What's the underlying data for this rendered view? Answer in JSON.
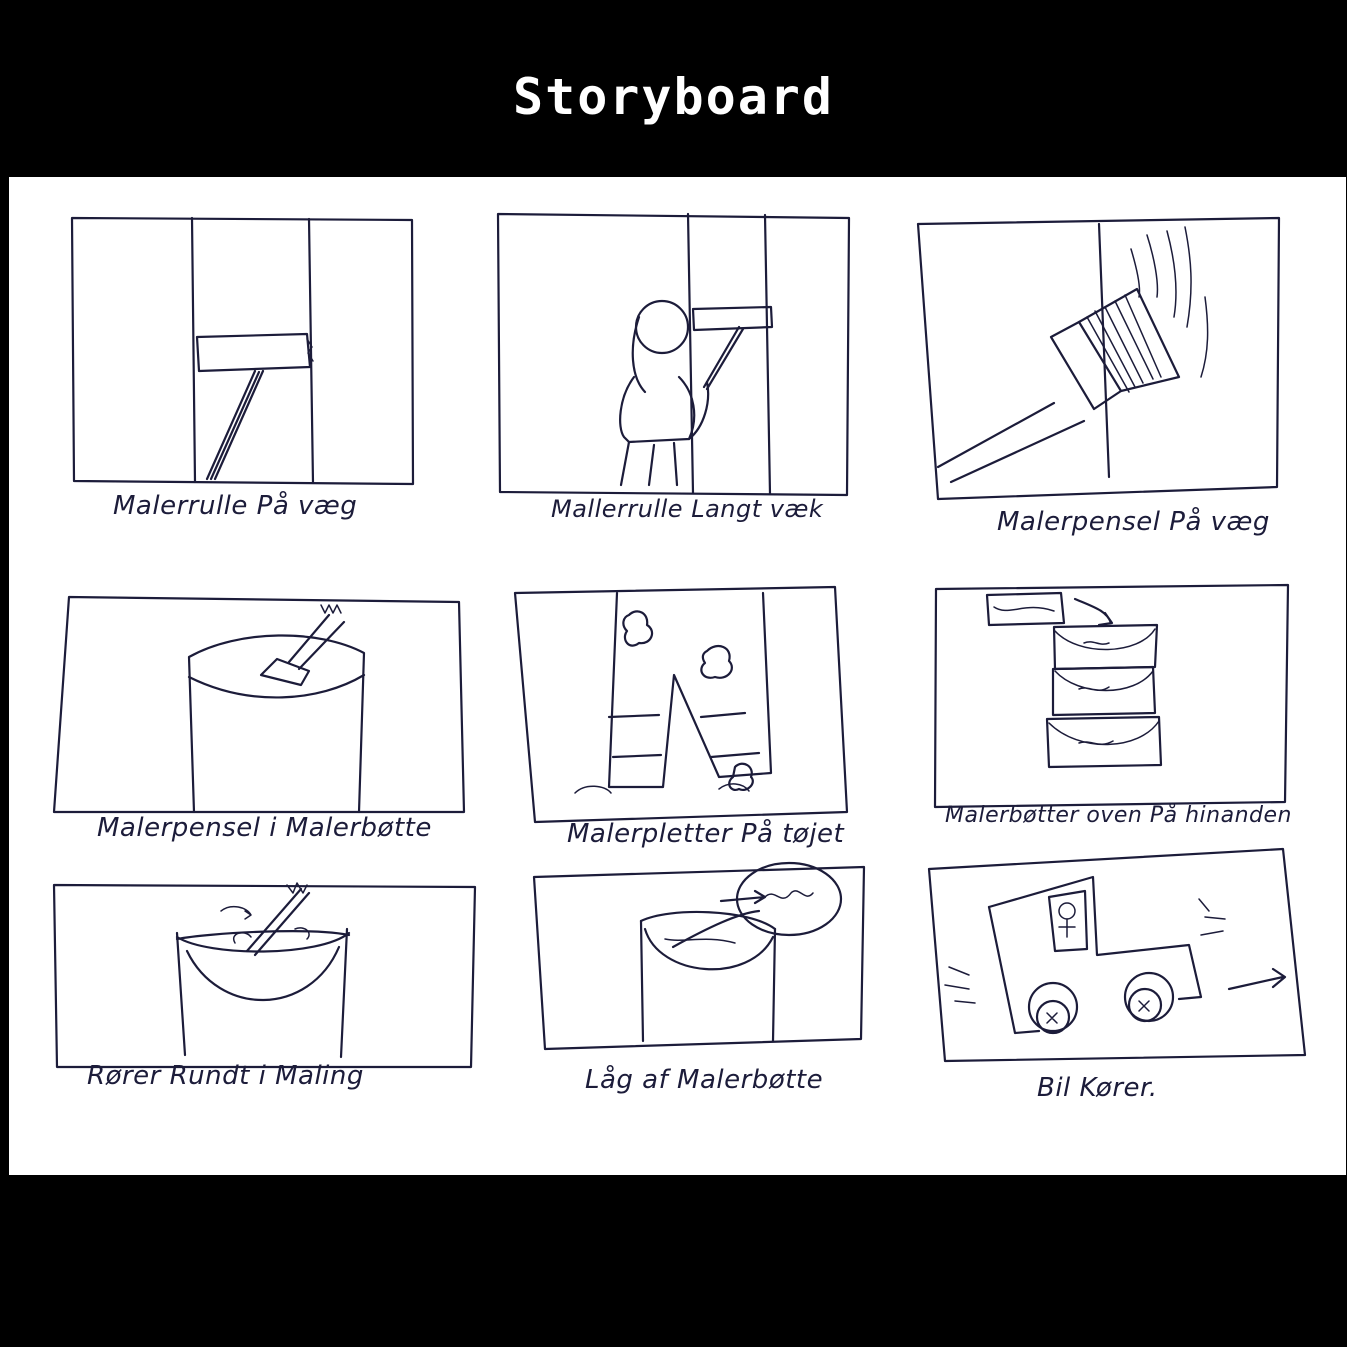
{
  "title": "Storyboard",
  "panels": [
    {
      "caption": "Malerrulle På væg"
    },
    {
      "caption": "Mallerrulle Langt væk"
    },
    {
      "caption": "Malerpensel På væg"
    },
    {
      "caption": "Malerpensel i Malerbøtte"
    },
    {
      "caption": "Malerpletter På tøjet"
    },
    {
      "caption": "Malerbøtter oven På hinanden"
    },
    {
      "caption": "Rører Rundt i Maling"
    },
    {
      "caption": "Låg af Malerbøtte"
    },
    {
      "caption": "Bil Kører."
    }
  ],
  "colors": {
    "background": "#000000",
    "paper": "#ffffff",
    "ink": "#1c1c3a",
    "title": "#ffffff"
  }
}
